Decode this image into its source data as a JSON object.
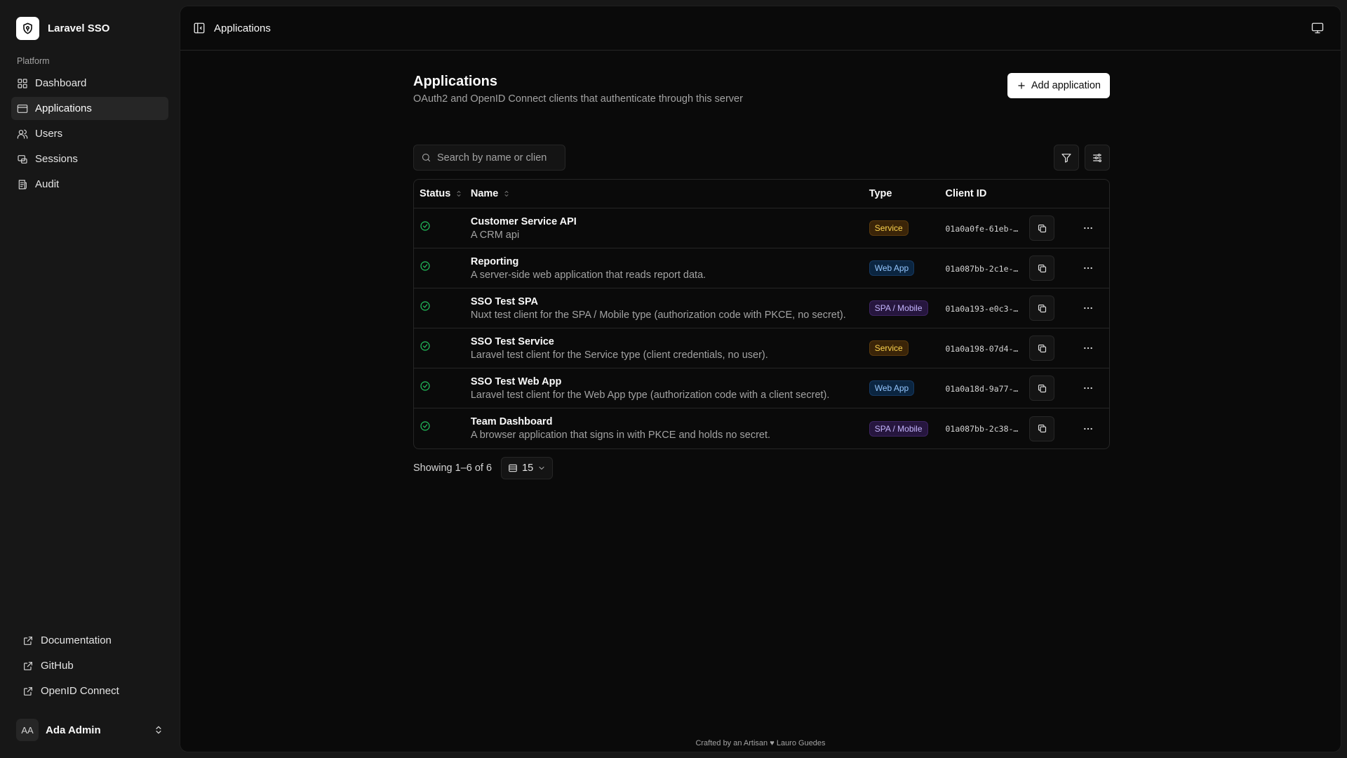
{
  "brand": {
    "name": "Laravel SSO"
  },
  "sidebar": {
    "group_label": "Platform",
    "items": [
      {
        "label": "Dashboard",
        "icon": "grid-icon"
      },
      {
        "label": "Applications",
        "icon": "app-window-icon",
        "active": true
      },
      {
        "label": "Users",
        "icon": "users-icon"
      },
      {
        "label": "Sessions",
        "icon": "sessions-icon"
      },
      {
        "label": "Audit",
        "icon": "audit-icon"
      }
    ],
    "bottom_links": [
      {
        "label": "Documentation",
        "icon": "external-link-icon"
      },
      {
        "label": "GitHub",
        "icon": "external-link-icon"
      },
      {
        "label": "OpenID Connect",
        "icon": "external-link-icon"
      }
    ],
    "user": {
      "initials": "AA",
      "name": "Ada Admin"
    }
  },
  "topbar": {
    "title": "Applications"
  },
  "page": {
    "title": "Applications",
    "subtitle": "OAuth2 and OpenID Connect clients that authenticate through this server",
    "add_label": "Add application"
  },
  "search": {
    "placeholder": "Search by name or clien",
    "value": ""
  },
  "table": {
    "headers": {
      "status": "Status",
      "name": "Name",
      "type": "Type",
      "client_id": "Client ID"
    },
    "rows": [
      {
        "name": "Customer Service API",
        "description": "A CRM api",
        "type": "Service",
        "client_id": "01a0a0fe-61eb-…",
        "status": "active"
      },
      {
        "name": "Reporting",
        "description": "A server-side web application that reads report data.",
        "type": "Web App",
        "client_id": "01a087bb-2c1e-…",
        "status": "active"
      },
      {
        "name": "SSO Test SPA",
        "description": "Nuxt test client for the SPA / Mobile type (authorization code with PKCE, no secret).",
        "type": "SPA / Mobile",
        "client_id": "01a0a193-e0c3-…",
        "status": "active"
      },
      {
        "name": "SSO Test Service",
        "description": "Laravel test client for the Service type (client credentials, no user).",
        "type": "Service",
        "client_id": "01a0a198-07d4-…",
        "status": "active"
      },
      {
        "name": "SSO Test Web App",
        "description": "Laravel test client for the Web App type (authorization code with a client secret).",
        "type": "Web App",
        "client_id": "01a0a18d-9a77-…",
        "status": "active"
      },
      {
        "name": "Team Dashboard",
        "description": "A browser application that signs in with PKCE and holds no secret.",
        "type": "SPA / Mobile",
        "client_id": "01a087bb-2c38-…",
        "status": "active"
      }
    ]
  },
  "pagination": {
    "showing": "Showing 1–6 of 6",
    "per_page": "15"
  },
  "footer": {
    "credit_prefix": "Crafted by an Artisan",
    "credit_suffix": "Lauro Guedes"
  },
  "colors": {
    "active_status": "#22c55e",
    "service": "#fcd34d",
    "web_app": "#93c5fd",
    "spa_mobile": "#c4b5fd"
  }
}
